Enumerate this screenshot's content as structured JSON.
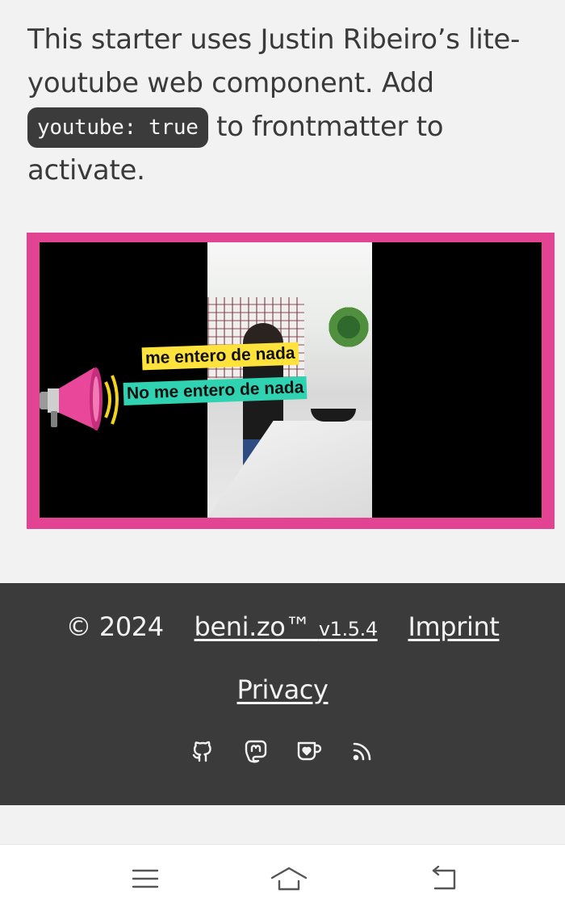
{
  "intro": {
    "text_before": "This starter uses Justin Ribeiro’s lite-youtube web component. Add ",
    "code": "youtube: true",
    "text_after": " to frontmatter to activate."
  },
  "video": {
    "caption_top": "me entero de nada",
    "caption_bottom": "No me entero de nada",
    "colors": {
      "border": "#e34393",
      "caption_top_bg": "#ffe23b",
      "caption_bottom_bg": "#2fd3b2"
    },
    "icon": "megaphone-icon"
  },
  "footer": {
    "copyright": "© 2024",
    "brand_link": "beni.zo™",
    "version": "v1.5.4",
    "imprint_link": "Imprint",
    "privacy_link": "Privacy",
    "icons": [
      "github-icon",
      "mastodon-icon",
      "kofi-icon",
      "rss-icon"
    ]
  },
  "navbar": {
    "icons": [
      "menu-icon",
      "home-icon",
      "back-icon"
    ]
  }
}
